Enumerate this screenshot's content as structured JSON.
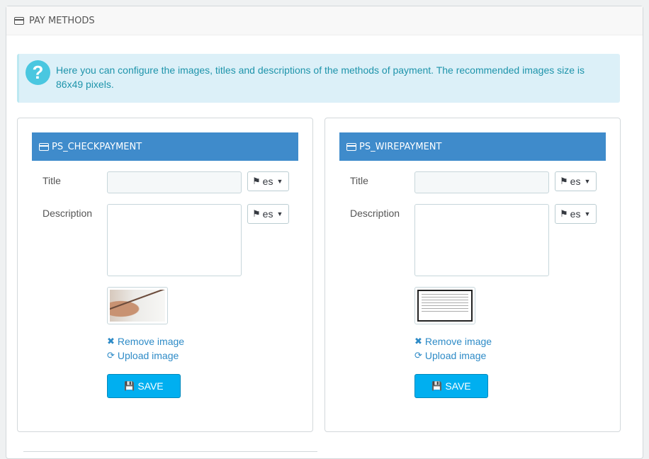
{
  "header": {
    "title": "PAY METHODS",
    "icon": "credit-card-icon"
  },
  "alert": {
    "icon": "help-icon",
    "text": "Here you can configure the images, titles and descriptions of the methods of payment. The recommended images size is 86x49 pixels."
  },
  "modules": [
    {
      "name": "PS_CHECKPAYMENT",
      "title_label": "Title",
      "title_value": "",
      "description_label": "Description",
      "description_value": "",
      "lang_title": "es",
      "lang_description": "es",
      "image": "check-payment-thumbnail",
      "remove_label": "Remove image",
      "upload_label": "Upload image",
      "save_label": "SAVE"
    },
    {
      "name": "PS_WIREPAYMENT",
      "title_label": "Title",
      "title_value": "",
      "description_label": "Description",
      "description_value": "",
      "lang_title": "es",
      "lang_description": "es",
      "image": "wire-payment-thumbnail",
      "remove_label": "Remove image",
      "upload_label": "Upload image",
      "save_label": "SAVE"
    }
  ],
  "colors": {
    "module_header": "#3f8bcb",
    "save_button": "#00aff0",
    "alert_bg": "#dcf0f8",
    "alert_text": "#1e94ab",
    "link": "#2e8bc7"
  }
}
